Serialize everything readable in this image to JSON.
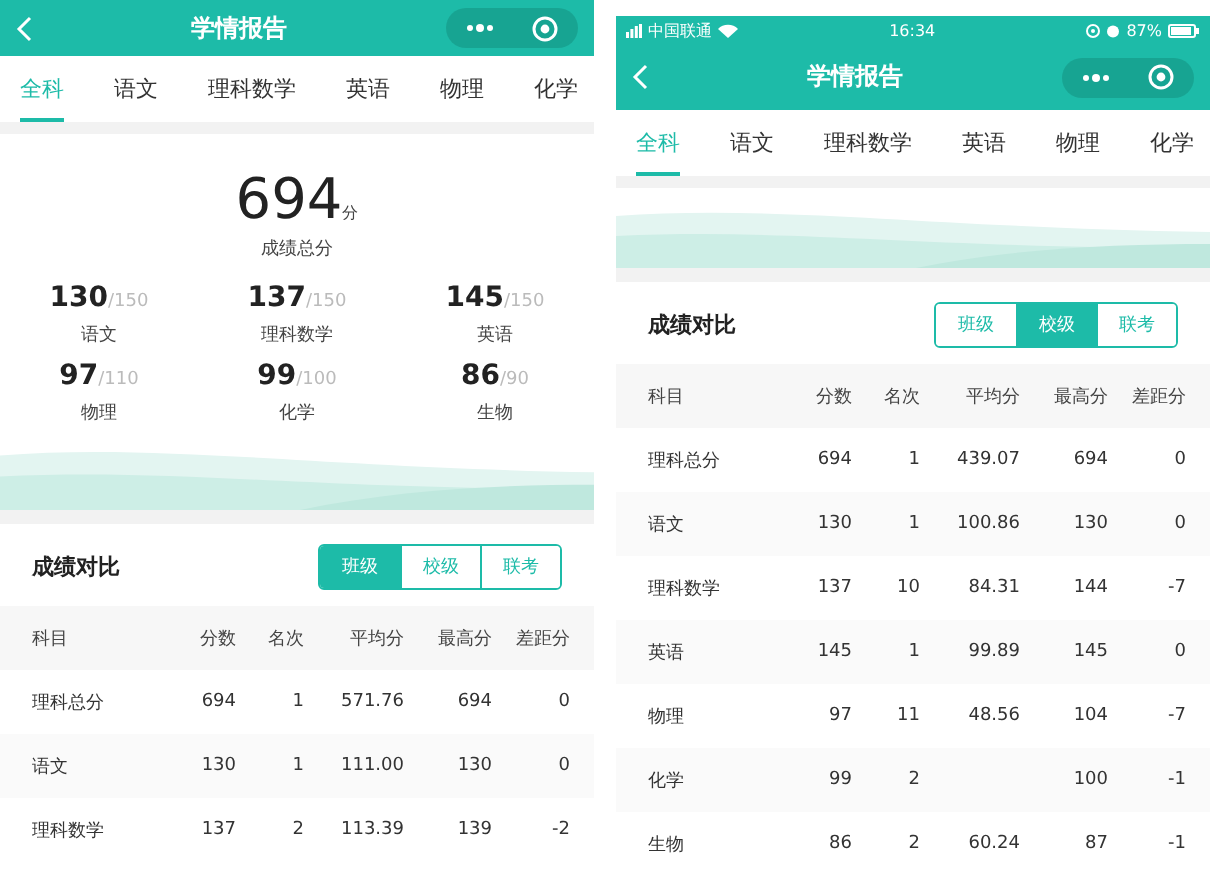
{
  "phones": [
    {
      "nav": {
        "title": "学情报告"
      },
      "tabs": [
        {
          "label": "全科",
          "selected": true
        },
        {
          "label": "语文",
          "selected": false
        },
        {
          "label": "理科数学",
          "selected": false
        },
        {
          "label": "英语",
          "selected": false
        },
        {
          "label": "物理",
          "selected": false
        },
        {
          "label": "化学",
          "selected": false
        }
      ],
      "summary": {
        "total": "694",
        "unit": "分",
        "total_label": "成绩总分",
        "subjects": [
          {
            "score": "130",
            "full": "/150",
            "name": "语文"
          },
          {
            "score": "137",
            "full": "/150",
            "name": "理科数学"
          },
          {
            "score": "145",
            "full": "/150",
            "name": "英语"
          },
          {
            "score": "97",
            "full": "/110",
            "name": "物理"
          },
          {
            "score": "99",
            "full": "/100",
            "name": "化学"
          },
          {
            "score": "86",
            "full": "/90",
            "name": "生物"
          }
        ]
      },
      "comparison": {
        "title": "成绩对比",
        "scopes": [
          {
            "label": "班级",
            "selected": true
          },
          {
            "label": "校级",
            "selected": false
          },
          {
            "label": "联考",
            "selected": false
          }
        ]
      },
      "table": {
        "columns": [
          "科目",
          "分数",
          "名次",
          "平均分",
          "最高分",
          "差距分"
        ],
        "rows": [
          [
            "理科总分",
            "694",
            "1",
            "571.76",
            "694",
            "0"
          ],
          [
            "语文",
            "130",
            "1",
            "111.00",
            "130",
            "0"
          ],
          [
            "理科数学",
            "137",
            "2",
            "113.39",
            "139",
            "-2"
          ]
        ]
      }
    },
    {
      "status_bar": {
        "carrier": "中国联通",
        "time": "16:34",
        "battery": "87%"
      },
      "nav": {
        "title": "学情报告"
      },
      "tabs": [
        {
          "label": "全科",
          "selected": true
        },
        {
          "label": "语文",
          "selected": false
        },
        {
          "label": "理科数学",
          "selected": false
        },
        {
          "label": "英语",
          "selected": false
        },
        {
          "label": "物理",
          "selected": false
        },
        {
          "label": "化学",
          "selected": false
        }
      ],
      "comparison": {
        "title": "成绩对比",
        "scopes": [
          {
            "label": "班级",
            "selected": false
          },
          {
            "label": "校级",
            "selected": true
          },
          {
            "label": "联考",
            "selected": false
          }
        ]
      },
      "table": {
        "columns": [
          "科目",
          "分数",
          "名次",
          "平均分",
          "最高分",
          "差距分"
        ],
        "rows": [
          [
            "理科总分",
            "694",
            "1",
            "439.07",
            "694",
            "0"
          ],
          [
            "语文",
            "130",
            "1",
            "100.86",
            "130",
            "0"
          ],
          [
            "理科数学",
            "137",
            "10",
            "84.31",
            "144",
            "-7"
          ],
          [
            "英语",
            "145",
            "1",
            "99.89",
            "145",
            "0"
          ],
          [
            "物理",
            "97",
            "11",
            "48.56",
            "104",
            "-7"
          ],
          [
            "化学",
            "99",
            "2",
            null,
            "100",
            "-1"
          ],
          [
            "生物",
            "86",
            "2",
            "60.24",
            "87",
            "-1"
          ]
        ]
      }
    }
  ]
}
